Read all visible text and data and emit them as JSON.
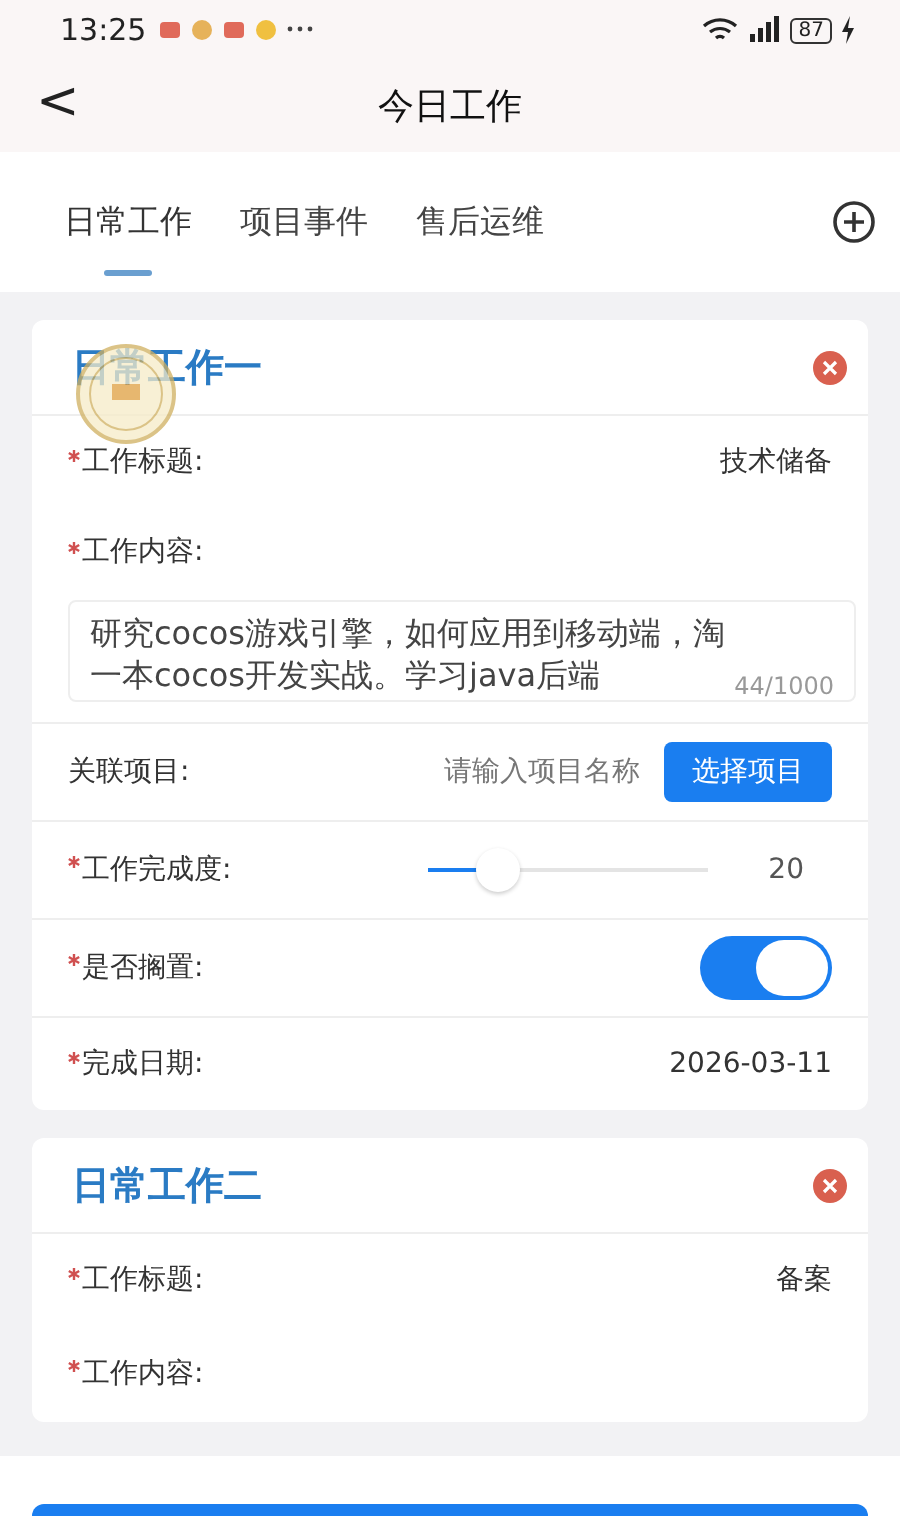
{
  "status_bar": {
    "time": "13:25",
    "battery": "87"
  },
  "nav": {
    "back": "<",
    "title": "今日工作"
  },
  "tabs": [
    {
      "label": "日常工作",
      "selected": true
    },
    {
      "label": "项目事件",
      "selected": false
    },
    {
      "label": "售后运维",
      "selected": false
    }
  ],
  "cards": [
    {
      "title": "日常工作一",
      "stamped": true,
      "fields": [
        {
          "kind": "text",
          "label": "工作标题:",
          "required": true,
          "value": "技术储备"
        },
        {
          "kind": "textarea",
          "label": "工作内容:",
          "required": true,
          "value": "研究cocos游戏引擎，如何应用到移动端，淘一本cocos开发实战。学习java后端",
          "counter": "44/1000"
        },
        {
          "kind": "picker",
          "label": "关联项目:",
          "required": false,
          "placeholder": "请输入项目名称",
          "button": "选择项目"
        },
        {
          "kind": "slider",
          "label": "工作完成度:",
          "required": true,
          "level": 0.2,
          "reading": "20"
        },
        {
          "kind": "switch",
          "label": "是否搁置:",
          "required": true,
          "on": true
        },
        {
          "kind": "text",
          "label": "完成日期:",
          "required": true,
          "value": "2026-03-11"
        }
      ]
    },
    {
      "title": "日常工作二",
      "stamped": false,
      "fields": [
        {
          "kind": "text",
          "label": "工作标题:",
          "required": true,
          "value": "备案"
        },
        {
          "kind": "label",
          "label": "工作内容:",
          "required": true
        }
      ]
    }
  ]
}
